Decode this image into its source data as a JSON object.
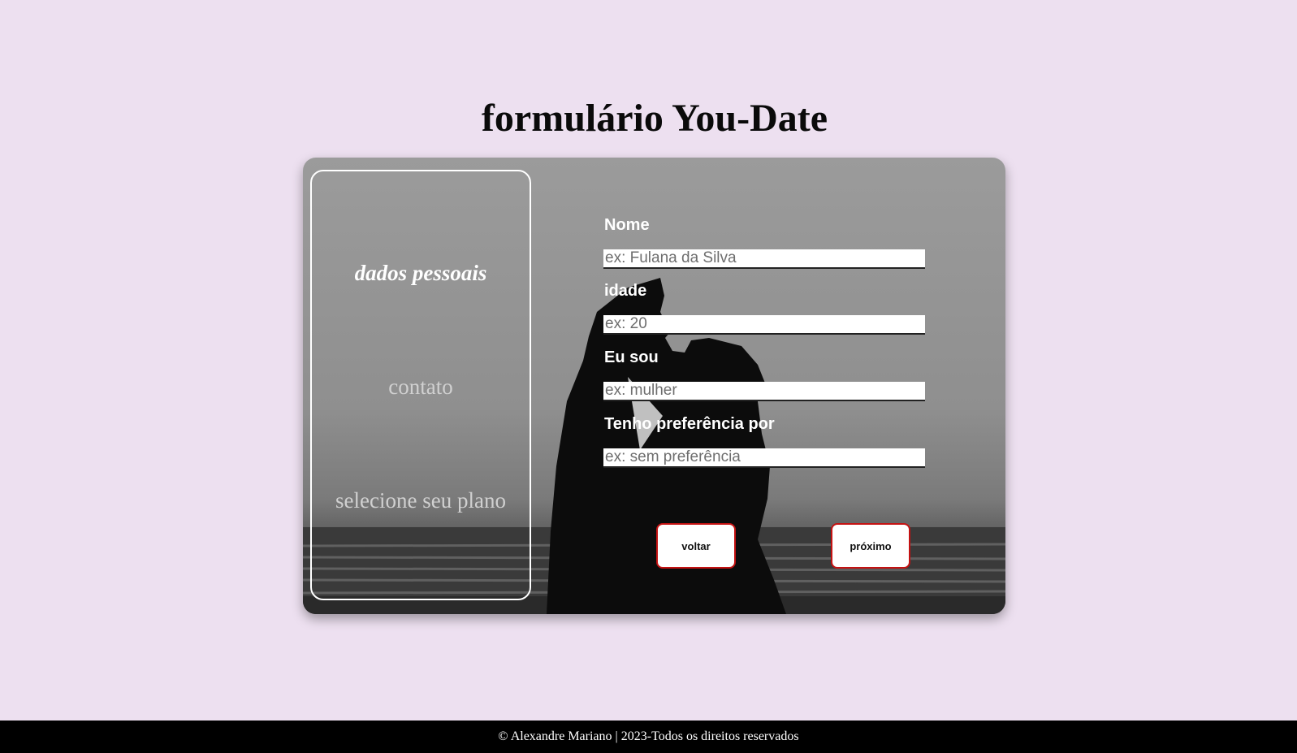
{
  "page": {
    "title": "formulário You-Date"
  },
  "steps": [
    {
      "label": "dados pessoais",
      "active": true
    },
    {
      "label": "contato",
      "active": false
    },
    {
      "label": "selecione seu plano",
      "active": false
    }
  ],
  "form": {
    "fields": [
      {
        "label": "Nome",
        "placeholder": "ex: Fulana da Silva",
        "value": ""
      },
      {
        "label": "idade",
        "placeholder": "ex: 20",
        "value": ""
      },
      {
        "label": "Eu sou",
        "placeholder": "ex: mulher",
        "value": ""
      },
      {
        "label": "Tenho preferência por",
        "placeholder": "ex: sem preferência",
        "value": ""
      }
    ],
    "back_label": "voltar",
    "next_label": "próximo"
  },
  "footer": {
    "text": "© Alexandre Mariano | 2023-Todos os direitos reservados"
  },
  "colors": {
    "background": "#ede0f0",
    "button_border": "#c41212",
    "footer_bg": "#000000"
  }
}
